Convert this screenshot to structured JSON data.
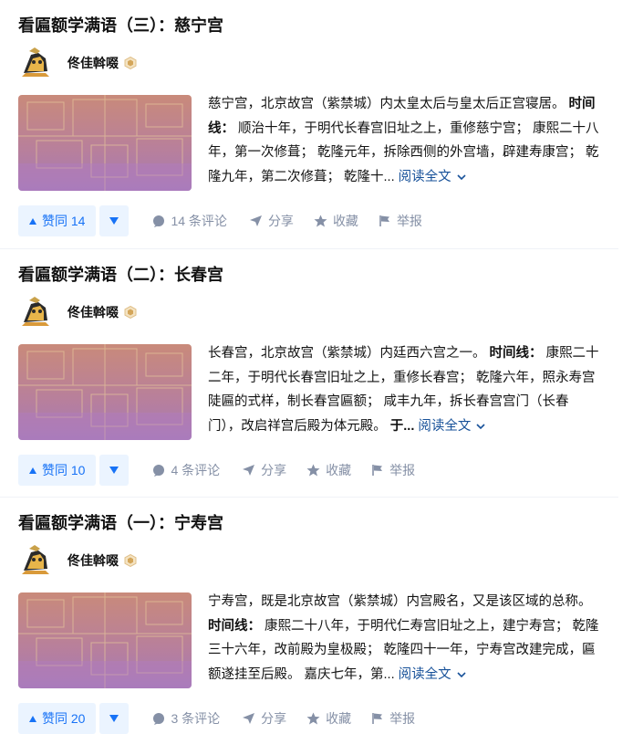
{
  "articles": [
    {
      "title": "看匾额学满语（三）：慈宁宫",
      "author": "佟佳斡啜",
      "excerpt_lead": "慈宁宫，北京故宫（紫禁城）内太皇太后与皇太后正宫寝居。",
      "excerpt_bold": "时间线：",
      "excerpt_rest": "顺治十年，于明代长春宫旧址之上，重修慈宁宫； 康熙二十八年，第一次修葺； 乾隆元年，拆除西侧的外宫墙，辟建寿康宫； 乾隆九年，第二次修葺； 乾隆十...",
      "read_more": "阅读全文",
      "upvote": "赞同 14",
      "comments": "14 条评论",
      "share": "分享",
      "favorite": "收藏",
      "report": "举报"
    },
    {
      "title": "看匾额学满语（二）：长春宫",
      "author": "佟佳斡啜",
      "excerpt_lead": "长春宫，北京故宫（紫禁城）内廷西六宫之一。",
      "excerpt_bold": "时间线：",
      "excerpt_rest": "康熙二十二年，于明代长春宫旧址之上，重修长春宫； 乾隆六年，照永寿宫陡匾的式样，制长春宫匾额； 咸丰九年，拆长春宫宫门（长春门），改启祥宫后殿为体元殿。",
      "excerpt_bold2": "于...",
      "read_more": "阅读全文",
      "upvote": "赞同 10",
      "comments": "4 条评论",
      "share": "分享",
      "favorite": "收藏",
      "report": "举报"
    },
    {
      "title": "看匾额学满语（一）：宁寿宫",
      "author": "佟佳斡啜",
      "excerpt_lead": "宁寿宫，既是北京故宫（紫禁城）内宫殿名，又是该区域的总称。",
      "excerpt_bold": "时间线：",
      "excerpt_rest": "康熙二十八年，于明代仁寿宫旧址之上，建宁寿宫； 乾隆三十六年，改前殿为皇极殿； 乾隆四十一年，宁寿宫改建完成，匾额遂挂至后殿。 嘉庆七年，第...",
      "read_more": "阅读全文",
      "upvote": "赞同 20",
      "comments": "3 条评论",
      "share": "分享",
      "favorite": "收藏",
      "report": "举报"
    }
  ],
  "colors": {
    "accent": "#1772f6",
    "link": "#175199",
    "muted": "#8590a6",
    "vote_bg": "#ebf4ff"
  }
}
